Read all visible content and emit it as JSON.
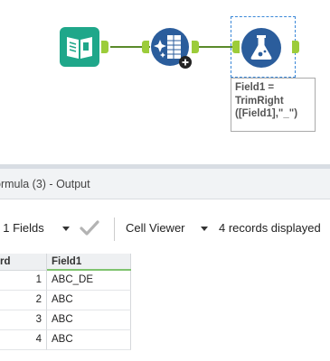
{
  "workflow": {
    "annotation_lines": [
      "Field1 =",
      "TrimRight",
      "([Field1],\"_\")"
    ],
    "tools": [
      {
        "name": "Input Data",
        "icon": "book-icon",
        "color": "#1fa78a"
      },
      {
        "name": "Select Records",
        "icon": "select-records-icon",
        "color": "#2b5d9c"
      },
      {
        "name": "Formula",
        "icon": "flask-icon",
        "color": "#2b5d9c"
      }
    ],
    "connector_color": "#5a8a2a",
    "anchor_color": "#9ccc3a"
  },
  "results": {
    "title": "ormula (3) - Output",
    "fields_selector": "f 1 Fields",
    "viewer_selector": "Cell Viewer",
    "records_status": "4 records displayed",
    "columns": [
      "rd",
      "Field1"
    ],
    "rows": [
      {
        "record": "1",
        "field1": "ABC_DE"
      },
      {
        "record": "2",
        "field1": "ABC"
      },
      {
        "record": "3",
        "field1": "ABC"
      },
      {
        "record": "4",
        "field1": "ABC"
      }
    ]
  }
}
